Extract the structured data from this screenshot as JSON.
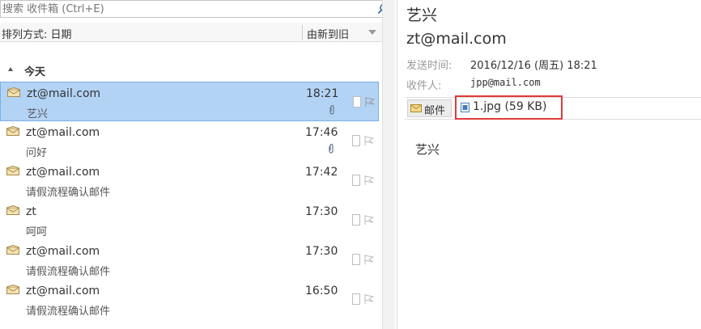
{
  "search": {
    "placeholder": "搜索 收件箱 (Ctrl+E)"
  },
  "sort": {
    "label": "排列方式: 日期",
    "order": "由新到旧"
  },
  "group": {
    "label": "今天"
  },
  "mails": [
    {
      "sender": "zt@mail.com",
      "subject": "艺兴",
      "time": "18:21",
      "has_attachment": true,
      "selected": true
    },
    {
      "sender": "zt@mail.com",
      "subject": "问好",
      "time": "17:46",
      "has_attachment": true,
      "selected": false
    },
    {
      "sender": "zt@mail.com",
      "subject": "请假流程确认邮件",
      "time": "17:42",
      "has_attachment": false,
      "selected": false
    },
    {
      "sender": "zt",
      "subject": "呵呵",
      "time": "17:30",
      "has_attachment": false,
      "selected": false
    },
    {
      "sender": "zt@mail.com",
      "subject": "请假流程确认邮件",
      "time": "17:30",
      "has_attachment": false,
      "selected": false
    },
    {
      "sender": "zt@mail.com",
      "subject": "请假流程确认邮件",
      "time": "16:50",
      "has_attachment": false,
      "selected": false
    }
  ],
  "reading": {
    "subject": "艺兴",
    "from": "zt@mail.com",
    "sent_label": "发送时间:",
    "sent_value": "2016/12/16 (周五) 18:21",
    "to_label": "收件人:",
    "to_value": "jpp@mail.com",
    "mail_tab": "邮件",
    "attachment": "1.jpg (59 KB)",
    "body": "艺兴"
  },
  "colors": {
    "selection": "#b3d3f5",
    "highlight_border": "#e03a3a"
  }
}
